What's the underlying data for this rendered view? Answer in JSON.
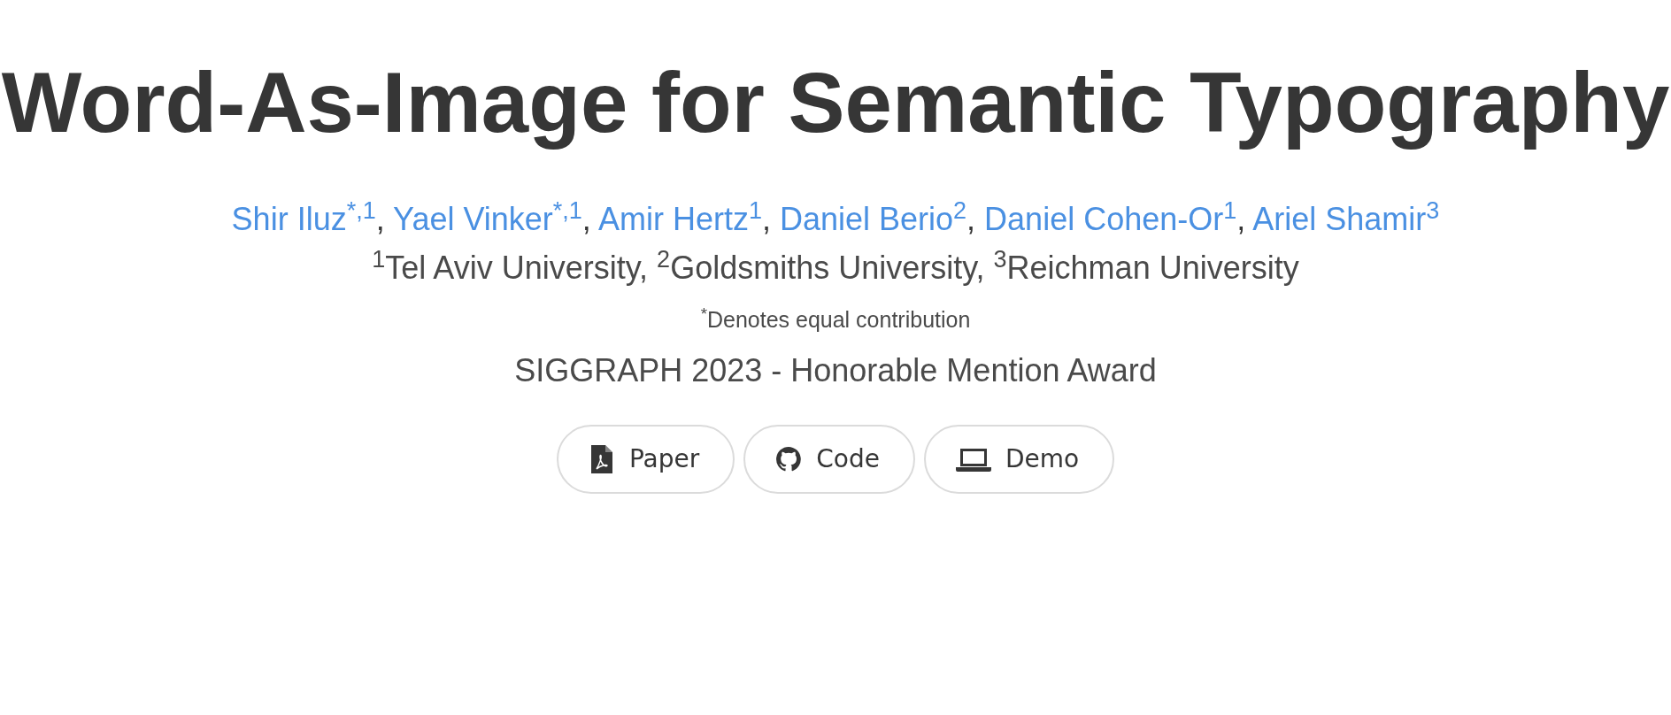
{
  "title": "Word-As-Image for Semantic Typography",
  "authors": [
    {
      "name": "Shir Iluz",
      "marks": "*,1",
      "separator": ","
    },
    {
      "name": "Yael Vinker",
      "marks": "*,1",
      "separator": ","
    },
    {
      "name": "Amir Hertz",
      "marks": "1",
      "separator": ","
    },
    {
      "name": "Daniel Berio",
      "marks": "2",
      "separator": ","
    },
    {
      "name": "Daniel Cohen-Or",
      "marks": "1",
      "separator": ","
    },
    {
      "name": "Ariel Shamir",
      "marks": "3"
    }
  ],
  "affiliations": "$^{1}$Tel Aviv University, $^{2}$Goldsmiths University, $^{3}$Reichman University",
  "note": "$^{*}$Denotes equal contribution",
  "venue": "SIGGRAPH 2023 - Honorable Mention Award",
  "buttons": [
    {
      "label": "Paper",
      "kind": "pdf"
    },
    {
      "label": "Code",
      "kind": "github"
    },
    {
      "label": "Demo",
      "kind": "laptop"
    }
  ]
}
